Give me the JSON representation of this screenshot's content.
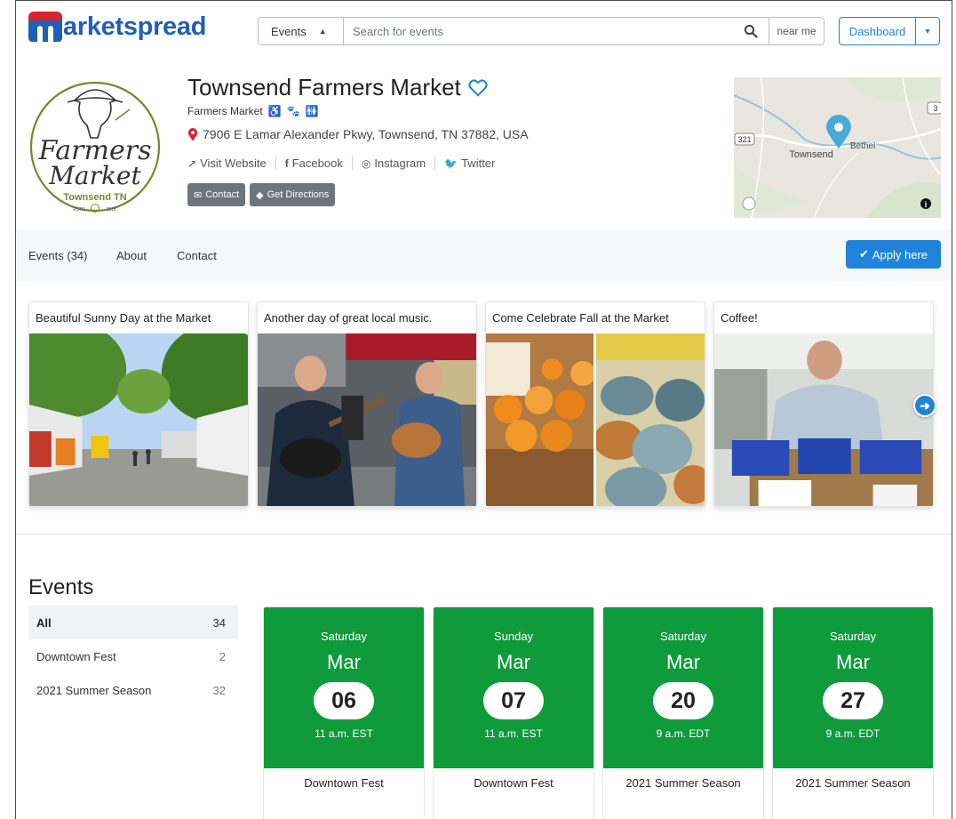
{
  "header": {
    "logo_text": "arketspread",
    "search_type": "Events",
    "search_placeholder": "Search for events",
    "near_me": "near me",
    "dashboard": "Dashboard"
  },
  "profile": {
    "name": "Townsend Farmers Market",
    "type": "Farmers Market",
    "address": "7906 E Lamar Alexander Pkwy, Townsend, TN 37882, USA",
    "links": {
      "website": "Visit Website",
      "facebook": "Facebook",
      "instagram": "Instagram",
      "twitter": "Twitter"
    },
    "buttons": {
      "contact": "Contact",
      "directions": "Get Directions"
    },
    "logo": {
      "line1": "Farmers",
      "line2": "Market",
      "line3": "Townsend TN",
      "estd": "ESTD",
      "year": "2018"
    }
  },
  "map": {
    "labels": [
      "Townsend",
      "Bethel",
      "321",
      "3"
    ]
  },
  "nav": {
    "items": [
      "Events (34)",
      "About",
      "Contact"
    ],
    "apply": "Apply here"
  },
  "gallery": [
    {
      "caption": "Beautiful Sunny Day at the Market"
    },
    {
      "caption": "Another day of great local music."
    },
    {
      "caption": "Come Celebrate Fall at the Market"
    },
    {
      "caption": "Coffee!"
    }
  ],
  "events": {
    "title": "Events",
    "filters": [
      {
        "label": "All",
        "count": "34"
      },
      {
        "label": "Downtown Fest",
        "count": "2"
      },
      {
        "label": "2021 Summer Season",
        "count": "32"
      }
    ],
    "cards": [
      {
        "dow": "Saturday",
        "month": "Mar",
        "day": "06",
        "time": "11 a.m. EST",
        "name": "Downtown Fest"
      },
      {
        "dow": "Sunday",
        "month": "Mar",
        "day": "07",
        "time": "11 a.m. EST",
        "name": "Downtown Fest"
      },
      {
        "dow": "Saturday",
        "month": "Mar",
        "day": "20",
        "time": "9 a.m. EDT",
        "name": "2021 Summer Season"
      },
      {
        "dow": "Saturday",
        "month": "Mar",
        "day": "27",
        "time": "9 a.m. EDT",
        "name": "2021 Summer Season"
      }
    ]
  },
  "colors": {
    "brand_blue": "#1f5fb5",
    "brand_red": "#d9232d",
    "accent": "#1f84d9",
    "event_green": "#0f9a3c",
    "logo_olive": "#6f8a2b"
  }
}
